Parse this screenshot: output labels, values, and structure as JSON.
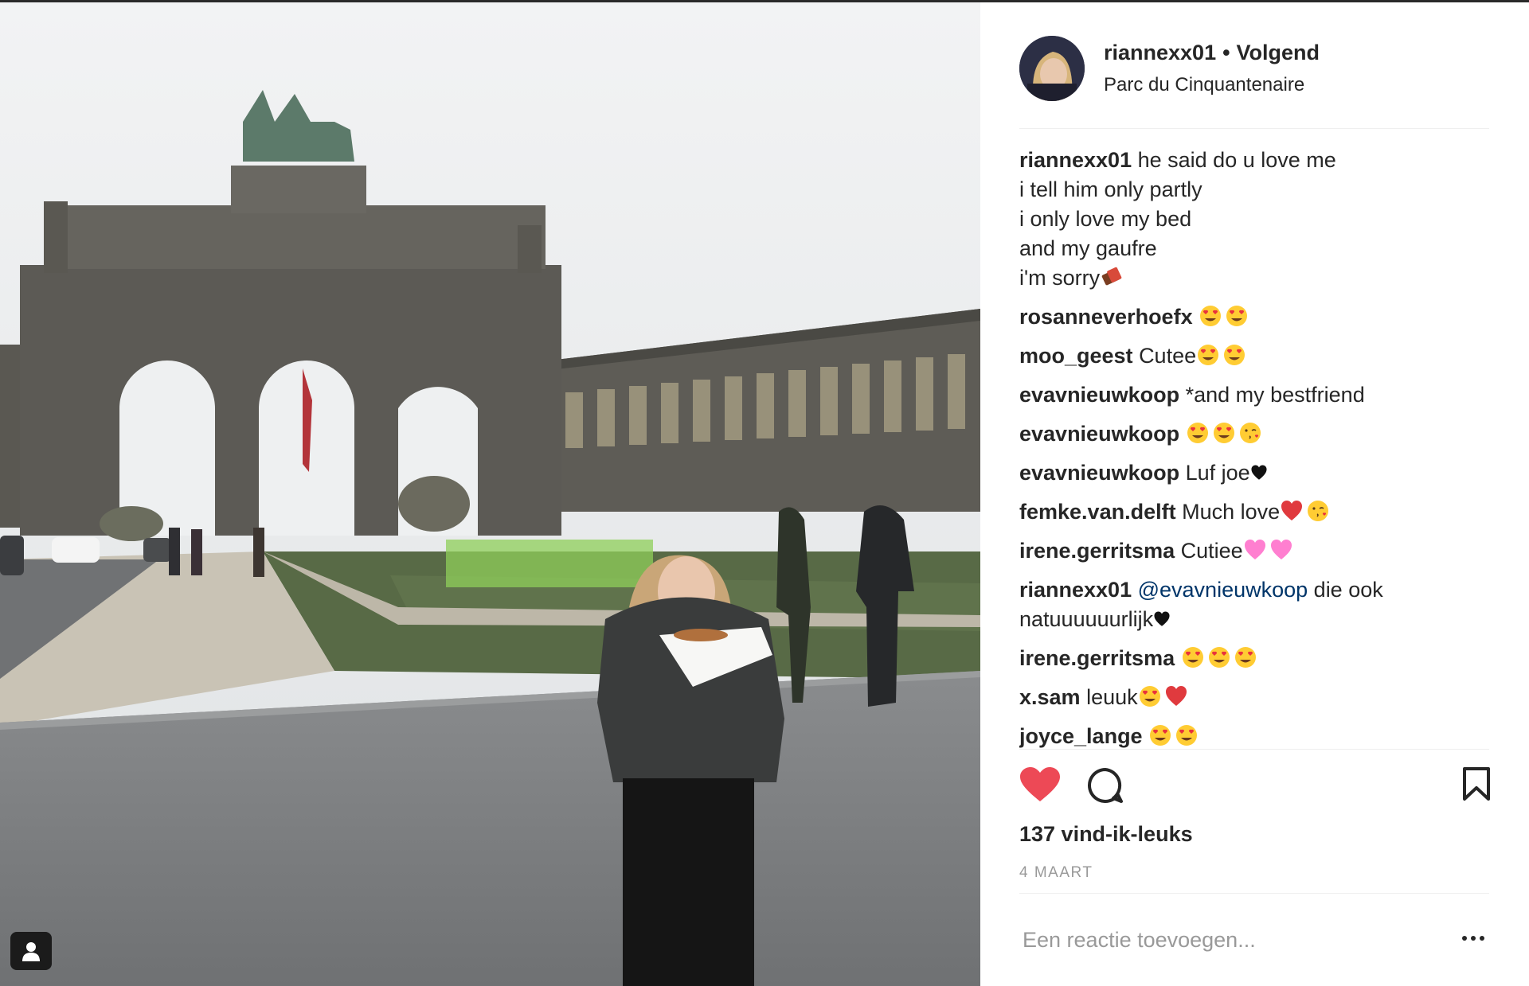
{
  "post": {
    "username": "riannexx01",
    "follow_label": "Volgend",
    "location": "Parc du Cinquantenaire"
  },
  "caption": {
    "user": "riannexx01",
    "lines": [
      "he said do u love me",
      "i tell him only partly",
      "i only love my bed",
      "and my gaufre",
      "i'm sorry"
    ]
  },
  "comments": [
    {
      "user": "rosanneverhoefx",
      "text": "",
      "emojis": [
        "heart-eyes",
        "heart-eyes"
      ]
    },
    {
      "user": "moo_geest",
      "text": "Cutee",
      "emojis": [
        "heart-eyes",
        "heart-eyes"
      ]
    },
    {
      "user": "evavnieuwkoop",
      "text": "*and my bestfriend",
      "emojis": []
    },
    {
      "user": "evavnieuwkoop",
      "text": "",
      "emojis": [
        "heart-eyes",
        "heart-eyes",
        "kiss-face"
      ]
    },
    {
      "user": "evavnieuwkoop",
      "text": "Luf joe",
      "emojis": [
        "black-heart"
      ]
    },
    {
      "user": "femke.van.delft",
      "text": "Much love",
      "emojis": [
        "red-heart",
        "kiss-face"
      ]
    },
    {
      "user": "irene.gerritsma",
      "text": "Cutiee",
      "emojis": [
        "pink-heart",
        "pink-heart"
      ]
    },
    {
      "user": "riannexx01",
      "mention": "@evavnieuwkoop",
      "text": "die ook natuuuuuurlijk",
      "emojis": [
        "black-heart"
      ]
    },
    {
      "user": "irene.gerritsma",
      "text": "",
      "emojis": [
        "heart-eyes",
        "heart-eyes",
        "heart-eyes"
      ]
    },
    {
      "user": "x.sam",
      "text": "leuuk",
      "emojis": [
        "heart-eyes",
        "red-heart"
      ]
    },
    {
      "user": "joyce_lange",
      "text": "",
      "emojis": [
        "heart-eyes",
        "heart-eyes"
      ]
    }
  ],
  "actions": {
    "like_icon": "heart-filled-icon",
    "comment_icon": "speech-bubble-icon",
    "save_icon": "bookmark-icon"
  },
  "likes_text": "137 vind-ik-leuks",
  "date_text": "4 MAART",
  "add_comment": {
    "placeholder": "Een reactie toevoegen..."
  },
  "colors": {
    "like_red": "#ed4956",
    "mention_blue": "#003569",
    "muted": "#999999"
  }
}
